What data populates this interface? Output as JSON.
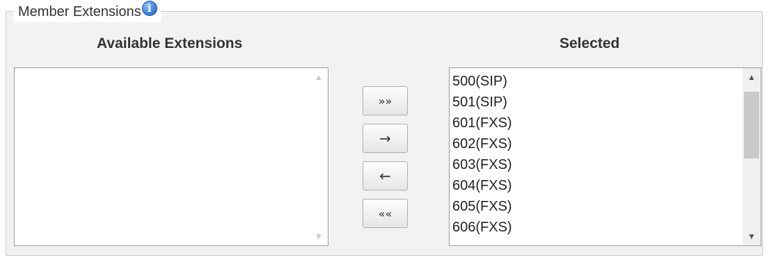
{
  "fieldset": {
    "legend": "Member Extensions",
    "info_icon": "info-icon"
  },
  "available": {
    "title": "Available Extensions",
    "items": []
  },
  "selected": {
    "title": "Selected",
    "items": [
      "500(SIP)",
      "501(SIP)",
      "601(FXS)",
      "602(FXS)",
      "603(FXS)",
      "604(FXS)",
      "605(FXS)",
      "606(FXS)"
    ]
  },
  "buttons": {
    "add_all": "»»",
    "add": "→",
    "remove": "←",
    "remove_all": "««"
  },
  "scroll_glyphs": {
    "up": "▲",
    "down": "▼"
  }
}
